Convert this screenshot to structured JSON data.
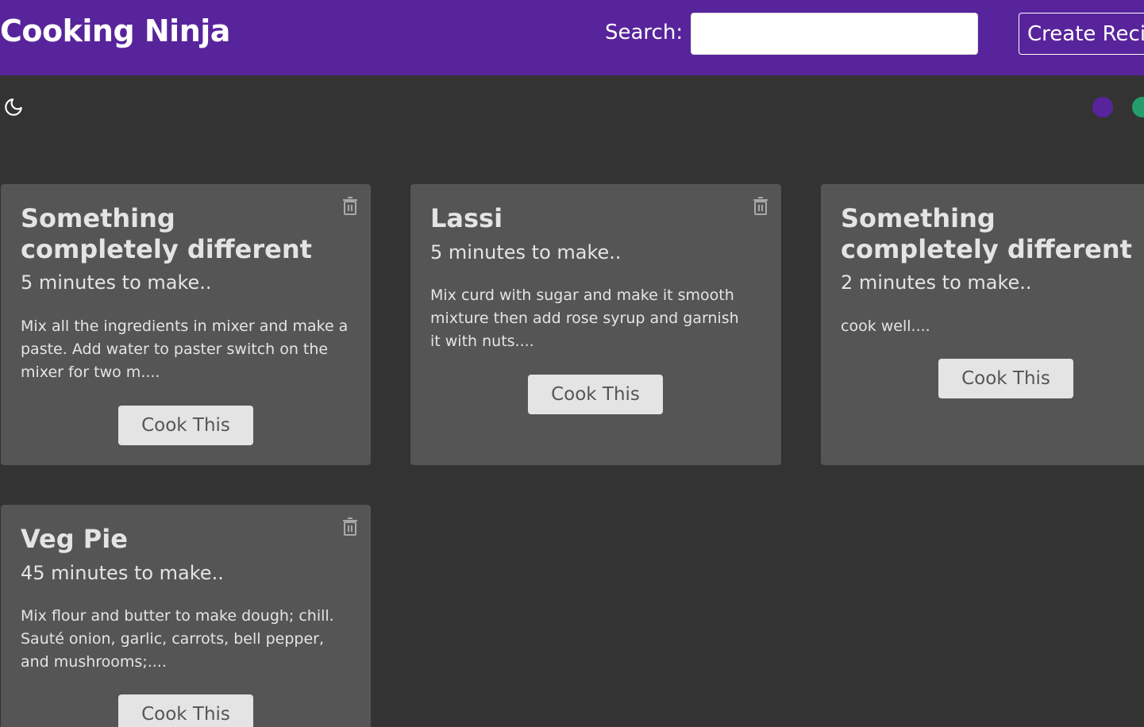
{
  "header": {
    "brand": "Cooking Ninja",
    "search_label": "Search:",
    "search_value": "",
    "create_label": "Create Recipe"
  },
  "theme": {
    "mode_icon": "moon-icon",
    "swatches": [
      "#58249c",
      "#249c6b",
      "#b70233"
    ]
  },
  "recipes": [
    {
      "title": "Something completely different",
      "time": "5 minutes to make..",
      "method": "Mix all the ingredients in mixer and make a paste. Add water to paster switch on the mixer for two m....",
      "button": "Cook This"
    },
    {
      "title": "Lassi",
      "time": "5 minutes to make..",
      "method": "Mix curd with sugar and make it smooth mixture then add rose syrup and garnish it with nuts....",
      "button": "Cook This"
    },
    {
      "title": "Something completely different",
      "time": "2 minutes to make..",
      "method": "cook well....",
      "button": "Cook This"
    },
    {
      "title": "Veg Pie",
      "time": "45 minutes to make..",
      "method": "Mix flour and butter to make dough; chill. Sauté onion, garlic, carrots, bell pepper, and mushrooms;....",
      "button": "Cook This"
    }
  ]
}
